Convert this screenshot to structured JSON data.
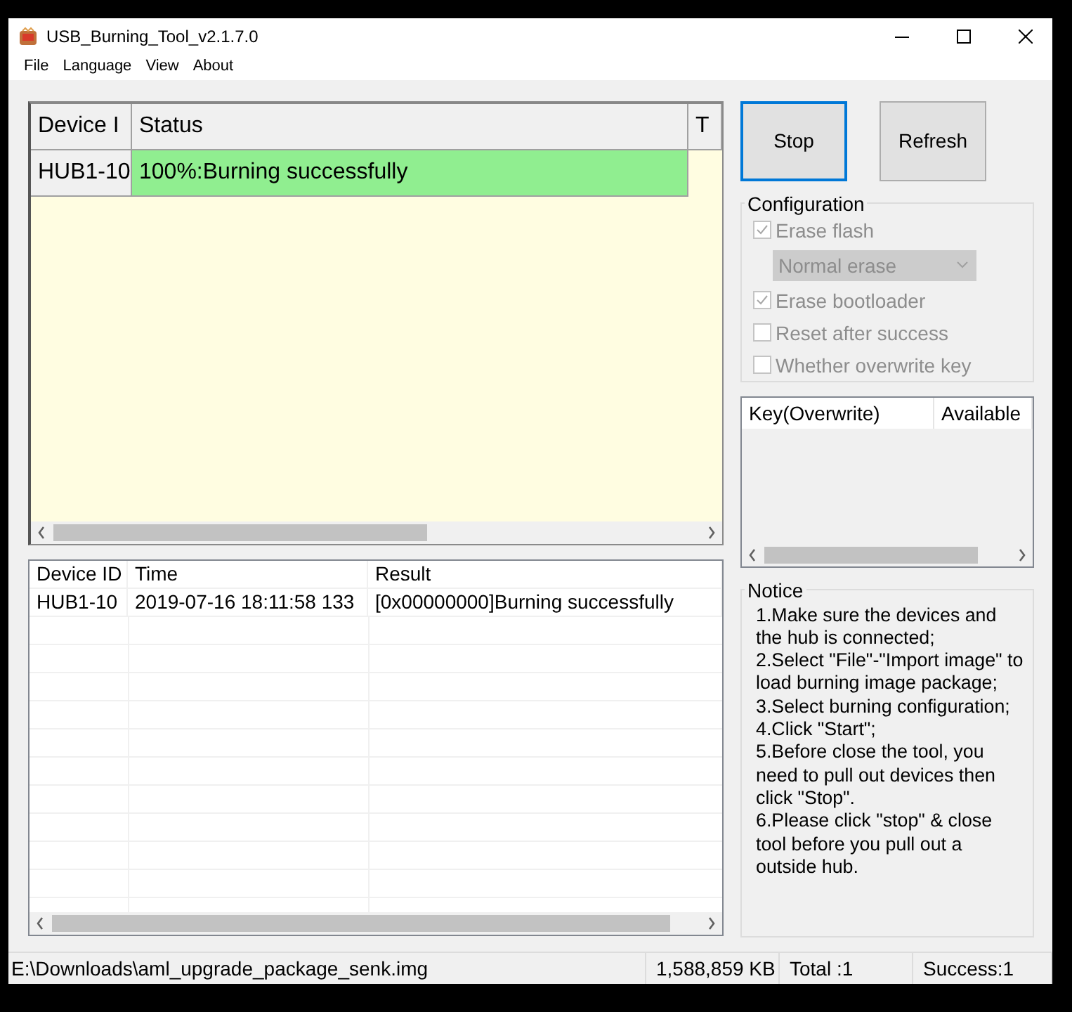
{
  "window": {
    "title": "USB_Burning_Tool_v2.1.7.0"
  },
  "menu": [
    "File",
    "Language",
    "View",
    "About"
  ],
  "device_table": {
    "columns": [
      "Device I",
      "Status",
      "T"
    ],
    "rows": [
      {
        "device": "HUB1-10",
        "status": "100%:Burning successfully",
        "success": true
      }
    ]
  },
  "buttons": [
    {
      "label": "Stop",
      "focused": true
    },
    {
      "label": "Refresh",
      "focused": false
    }
  ],
  "configuration": {
    "title": "Configuration",
    "items": [
      {
        "kind": "checkbox",
        "label": "Erase flash",
        "checked": true,
        "disabled": true
      },
      {
        "kind": "dropdown",
        "value": "Normal erase",
        "disabled": true
      },
      {
        "kind": "checkbox",
        "label": "Erase bootloader",
        "checked": true,
        "disabled": true
      },
      {
        "kind": "checkbox",
        "label": "Reset after success",
        "checked": false,
        "disabled": true
      },
      {
        "kind": "checkbox",
        "label": "Whether overwrite key",
        "checked": false,
        "disabled": true
      }
    ]
  },
  "key_table": {
    "columns": [
      "Key(Overwrite)",
      "Available"
    ]
  },
  "log_table": {
    "columns": [
      "Device ID",
      "Time",
      "Result"
    ],
    "rows": [
      [
        "HUB1-10",
        "2019-07-16 18:11:58 133",
        "[0x00000000]Burning successfully"
      ]
    ]
  },
  "notice": {
    "title": "Notice",
    "lines": [
      "1.Make sure the devices and the hub is connected;",
      "2.Select \"File\"-\"Import image\" to load burning image package;",
      "3.Select burning configuration;",
      "4.Click \"Start\";",
      "5.Before close the tool, you need to pull out devices then click \"Stop\".",
      "6.Please click \"stop\" & close tool before you pull out a outside hub."
    ]
  },
  "status_bar": [
    "E:\\Downloads\\aml_upgrade_package_senk.img",
    "1,588,859 KB",
    "Total :1",
    "Success:1"
  ]
}
